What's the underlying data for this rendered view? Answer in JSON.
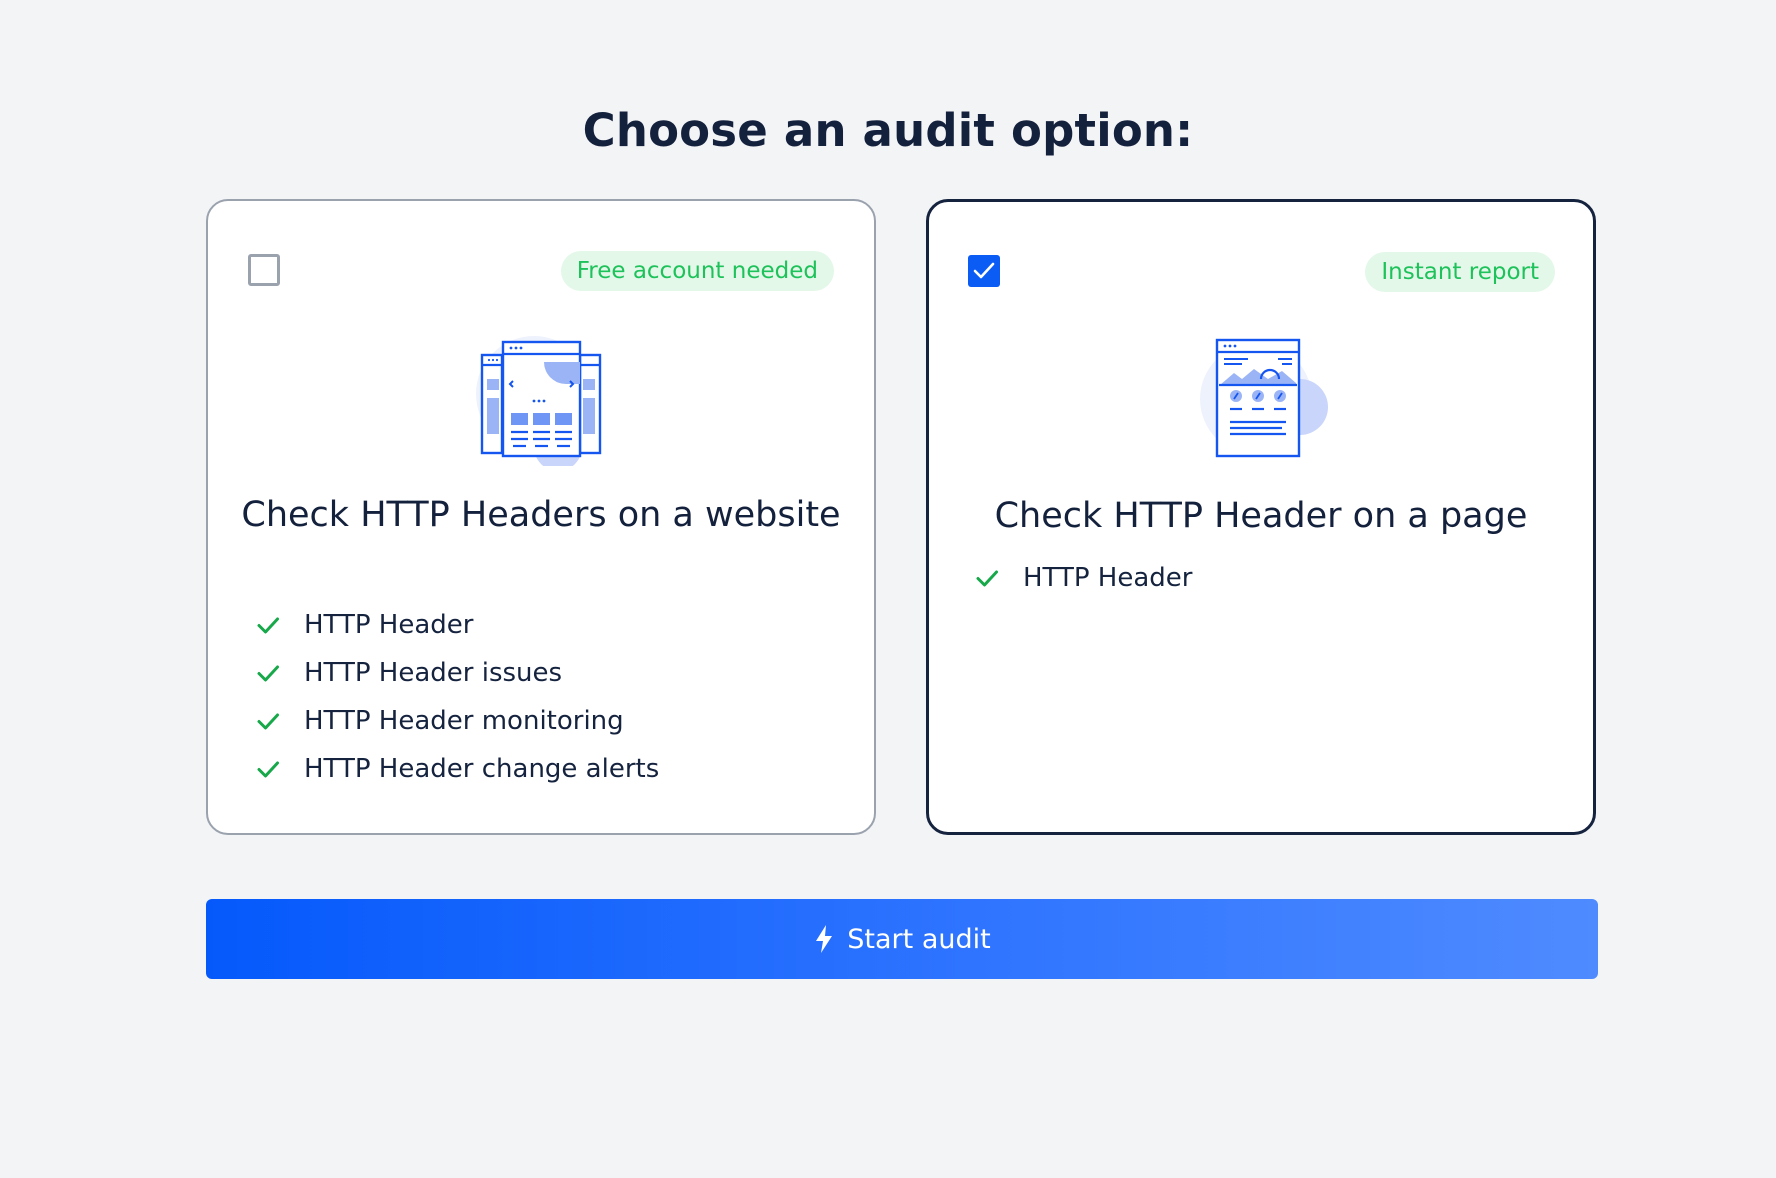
{
  "page": {
    "title": "Choose an audit option:"
  },
  "options": [
    {
      "checked": false,
      "badge": "Free account needed",
      "title": "Check HTTP Headers on a website",
      "features": [
        "HTTP Header",
        "HTTP Header issues",
        "HTTP Header monitoring",
        "HTTP Header change alerts"
      ],
      "illustration": "website-pages-icon"
    },
    {
      "checked": true,
      "badge": "Instant report",
      "title": "Check HTTP Header on a page",
      "features": [
        "HTTP Header"
      ],
      "illustration": "single-page-icon"
    }
  ],
  "actions": {
    "start_label": "Start audit",
    "start_icon": "lightning-bolt-icon"
  },
  "colors": {
    "background": "#f3f4f6",
    "title": "#14213d",
    "accent": "#0b5cf5",
    "badge_text": "#1ec25a",
    "badge_bg": "#e3f8e9",
    "check": "#17a84a",
    "selected_border": "#15233f",
    "unselected_border": "#9aa2ae"
  }
}
